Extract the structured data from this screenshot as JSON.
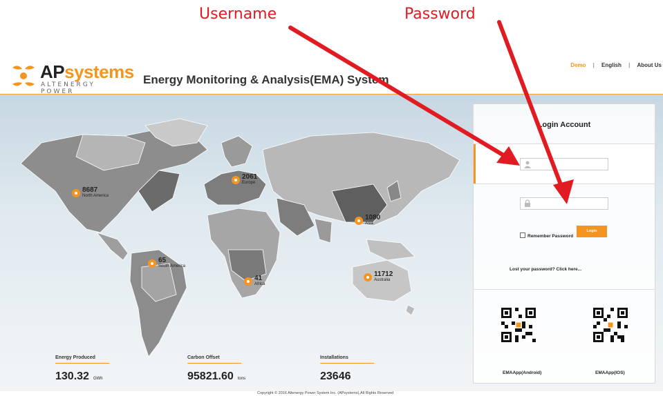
{
  "annotations": {
    "username": "Username",
    "password": "Password",
    "color": "#e11b22"
  },
  "header": {
    "logo_main": "AP",
    "logo_accent": "systems",
    "logo_sub": "ALTENERGY POWER",
    "title": "Energy Monitoring & Analysis(EMA) System",
    "nav": {
      "demo": "Demo",
      "sep": "|",
      "language": "English",
      "about": "About Us"
    }
  },
  "map_markers": [
    {
      "count": "8687",
      "region": "North America"
    },
    {
      "count": "2061",
      "region": "Europe"
    },
    {
      "count": "1080",
      "region": "Asia"
    },
    {
      "count": "65",
      "region": "South America"
    },
    {
      "count": "41",
      "region": "Africa"
    },
    {
      "count": "11712",
      "region": "Australia"
    }
  ],
  "stats": [
    {
      "label": "Energy Produced",
      "value": "130.32",
      "unit": "GWh"
    },
    {
      "label": "Carbon Offset",
      "value": "95821.60",
      "unit": "tons"
    },
    {
      "label": "Installations",
      "value": "23646",
      "unit": ""
    }
  ],
  "login": {
    "title": "Login Account",
    "username": {
      "value": "",
      "placeholder": ""
    },
    "password": {
      "value": "",
      "placeholder": ""
    },
    "remember_label": "Remember Password",
    "login_button": "Login",
    "lost_password": "Lost your password? Click here...",
    "qr_android_label": "EMAApp(Android)",
    "qr_ios_label": "EMAApp(IOS)"
  },
  "footer": {
    "copyright": "Copyright © 2016 Altenergy Power System Inc. (APsystems),All Rights Reserved"
  },
  "colors": {
    "accent": "#f39520",
    "annotation": "#e11b22"
  }
}
